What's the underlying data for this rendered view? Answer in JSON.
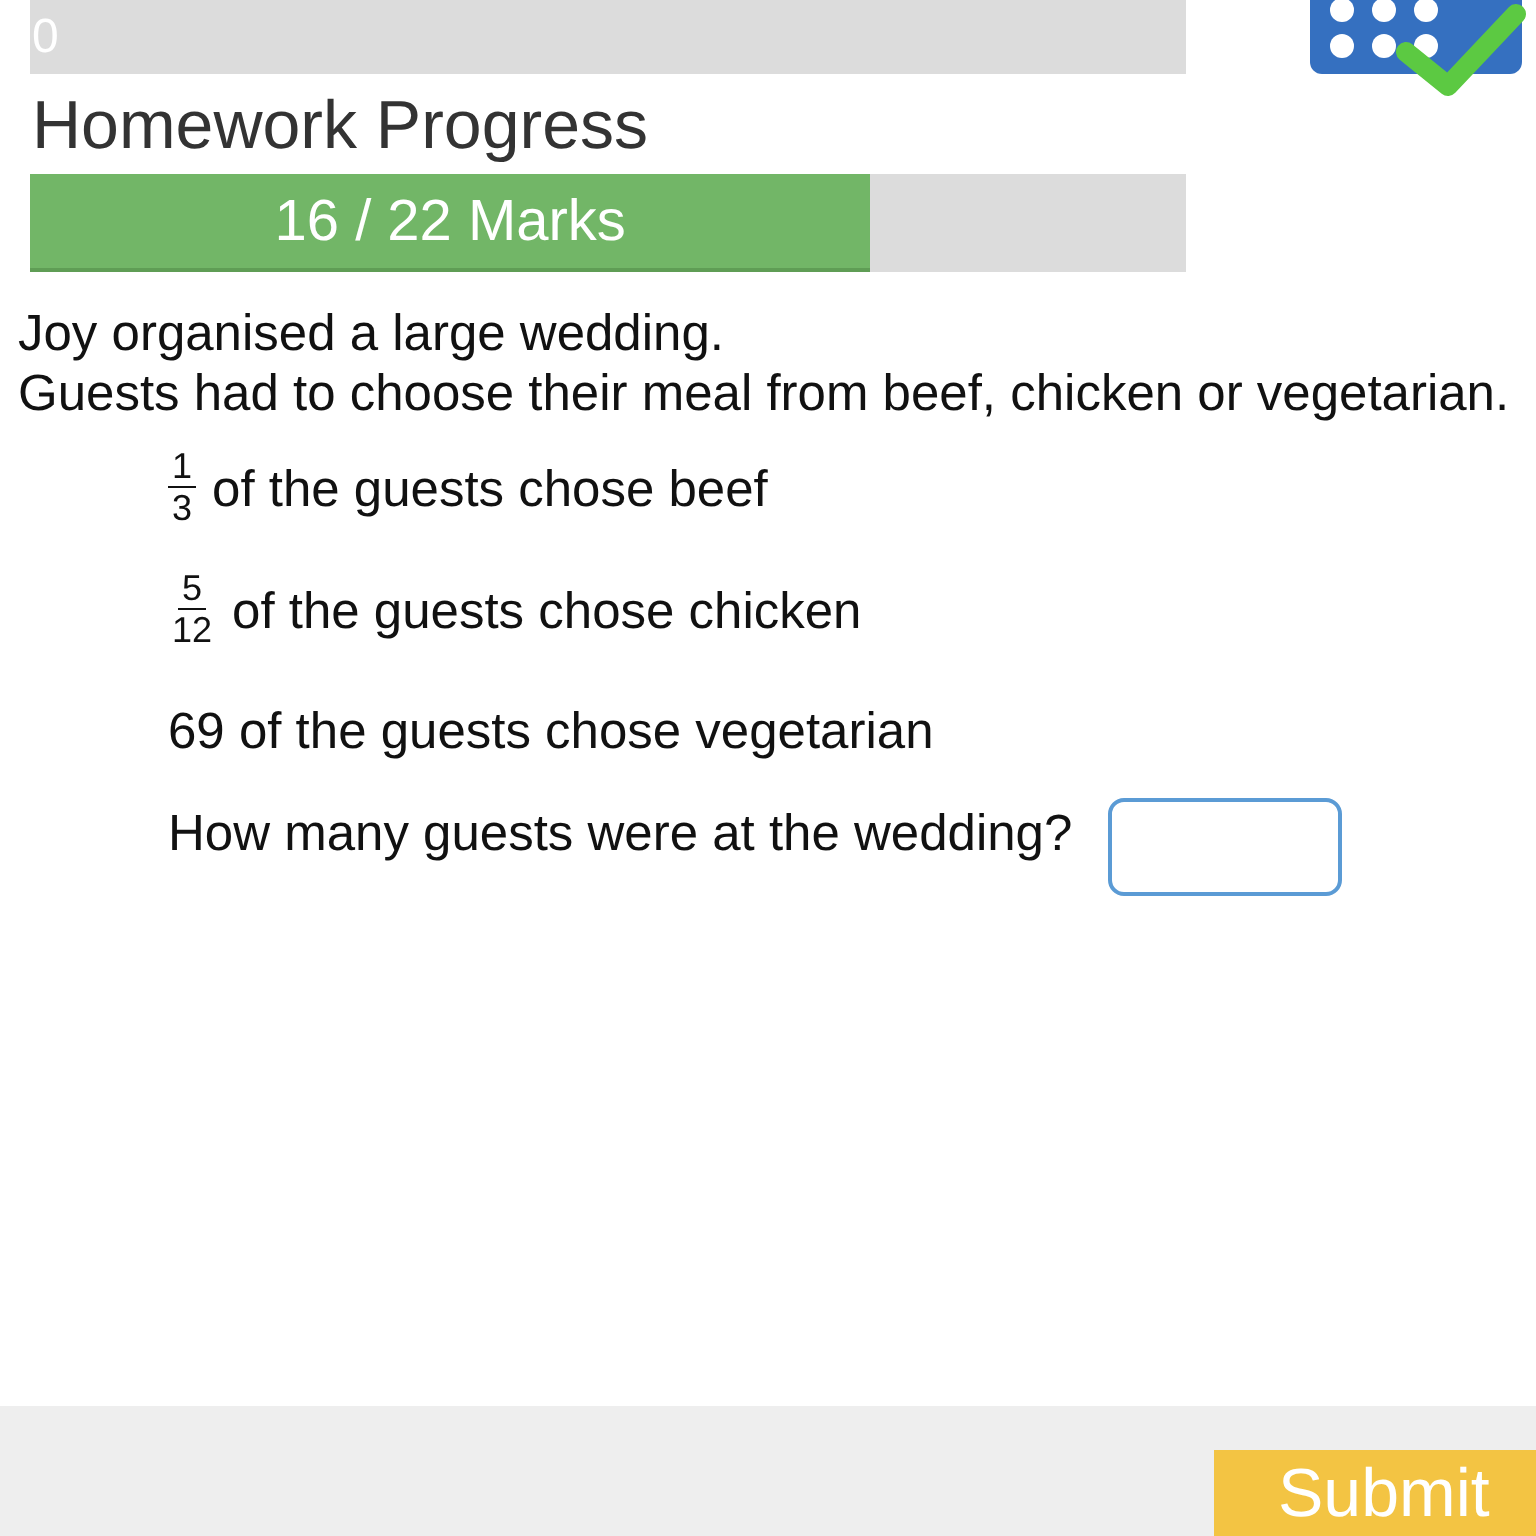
{
  "top_bar": {
    "label": "0"
  },
  "heading": "Homework Progress",
  "progress": {
    "label": "16 / 22 Marks",
    "level": 0.727
  },
  "question": {
    "intro": [
      "Joy organised a large wedding.",
      "Guests had to choose their meal from beef, chicken or vegetarian."
    ],
    "facts": [
      {
        "kind": "fraction",
        "numerator": "1",
        "denominator": "3",
        "text": "of the guests chose beef"
      },
      {
        "kind": "fraction",
        "numerator": "5",
        "denominator": "12",
        "text": "of the guests chose chicken"
      },
      {
        "kind": "plain",
        "text": "69 of the guests chose vegetarian"
      }
    ],
    "prompt": "How many guests were at the wedding?"
  },
  "footer": {
    "button": "Submit"
  }
}
